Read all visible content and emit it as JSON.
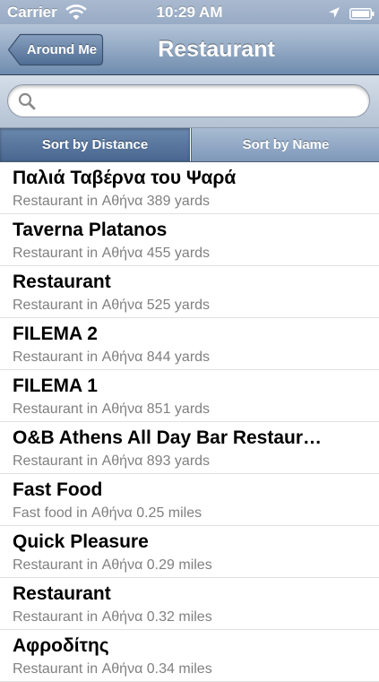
{
  "status_bar": {
    "carrier": "Carrier",
    "time": "10:29 AM",
    "icons": [
      "wifi-icon",
      "location-arrow-icon",
      "battery-icon"
    ]
  },
  "nav": {
    "back_label": "Around Me",
    "title": "Restaurant"
  },
  "search": {
    "value": "",
    "placeholder": "",
    "icon": "search-icon"
  },
  "sort": {
    "selected_label": "Sort by Distance",
    "other_label": "Sort by Name"
  },
  "colors": {
    "nav_bar": "#6e8bae",
    "segment_selected": "#48668f",
    "segment_unselected": "#7e98b9",
    "subtitle_text": "#808080"
  },
  "places": [
    {
      "title": "Παλιά Ταβέρνα του Ψαρά",
      "subtitle": "Restaurant in Αθήνα 389 yards"
    },
    {
      "title": "Taverna Platanos",
      "subtitle": "Restaurant in Αθήνα 455 yards"
    },
    {
      "title": "Restaurant",
      "subtitle": "Restaurant in Αθήνα 525 yards"
    },
    {
      "title": "FILEMA 2",
      "subtitle": "Restaurant in Αθήνα 844 yards"
    },
    {
      "title": "FILEMA 1",
      "subtitle": "Restaurant in Αθήνα 851 yards"
    },
    {
      "title": "O&B Athens All Day Bar Restaur…",
      "subtitle": "Restaurant in Αθήνα 893 yards"
    },
    {
      "title": "Fast Food",
      "subtitle": "Fast food in Αθήνα 0.25 miles"
    },
    {
      "title": "Quick Pleasure",
      "subtitle": "Restaurant in Αθήνα 0.29 miles"
    },
    {
      "title": "Restaurant",
      "subtitle": "Restaurant in Αθήνα 0.32 miles"
    },
    {
      "title": "Αφροδίτης",
      "subtitle": "Restaurant in Αθήνα 0.34 miles"
    }
  ]
}
